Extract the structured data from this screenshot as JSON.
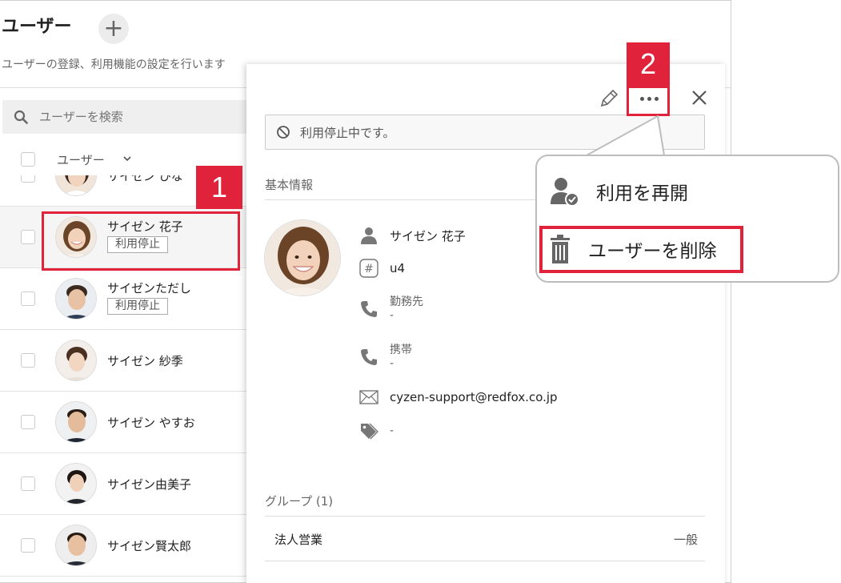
{
  "page": {
    "title": "ユーザー",
    "subtitle": "ユーザーの登録、利用機能の設定を行います"
  },
  "search": {
    "placeholder": "ユーザーを検索"
  },
  "list": {
    "header_label": "ユーザー",
    "rows": [
      {
        "name": "サイゼン ひな",
        "badge": ""
      },
      {
        "name": "サイゼン 花子",
        "badge": "利用停止"
      },
      {
        "name": "サイゼンただし",
        "badge": "利用停止"
      },
      {
        "name": "サイゼン 紗季",
        "badge": ""
      },
      {
        "name": "サイゼン やすお",
        "badge": ""
      },
      {
        "name": "サイゼン由美子",
        "badge": ""
      },
      {
        "name": "サイゼン賢太郎",
        "badge": ""
      }
    ]
  },
  "detail": {
    "status_message": "利用停止中です。",
    "basic_info_title": "基本情報",
    "name": "サイゼン 花子",
    "user_code": "u4",
    "work_phone_label": "勤務先",
    "work_phone_value": "-",
    "mobile_label": "携帯",
    "mobile_value": "-",
    "email": "cyzen-support@redfox.co.jp",
    "tags": "-",
    "group_title": "グループ (1)",
    "groups": [
      {
        "name": "法人営業",
        "role": "一般"
      }
    ]
  },
  "menu": {
    "resume_label": "利用を再開",
    "delete_label": "ユーザーを削除"
  },
  "annotations": {
    "step1": "1",
    "step2": "2",
    "color": "#e0223a"
  }
}
